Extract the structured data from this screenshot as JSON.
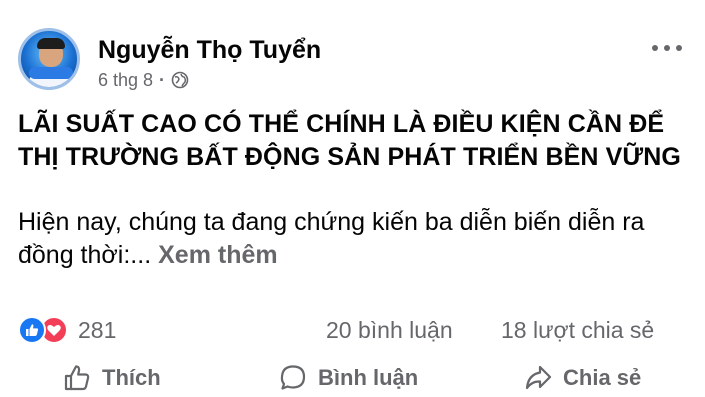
{
  "post": {
    "author": {
      "name": "Nguyễn Thọ Tuyển",
      "avatar_icon": "profile-photo"
    },
    "meta": {
      "date": "6 thg 8",
      "separator": "·",
      "privacy_icon": "globe-icon"
    },
    "headline": "LÃI SUẤT CAO CÓ THỂ CHÍNH LÀ ĐIỀU KIỆN CẦN ĐỂ THỊ TRƯỜNG BẤT ĐỘNG SẢN PHÁT TRIỂN BỀN VỮNG",
    "body": "Hiện nay, chúng ta đang chứng kiến ba diễn biến diễn ra đồng thời:...",
    "see_more": "Xem thêm"
  },
  "stats": {
    "reactions": [
      "like-icon",
      "love-icon"
    ],
    "reaction_count": "281",
    "comments": "20 bình luận",
    "shares": "18 lượt chia sẻ"
  },
  "actions": {
    "like": "Thích",
    "comment": "Bình luận",
    "share": "Chia sẻ"
  },
  "colors": {
    "text": "#050505",
    "secondary": "#65676b",
    "like_blue": "#1877f2",
    "love_red": "#f33e58"
  }
}
